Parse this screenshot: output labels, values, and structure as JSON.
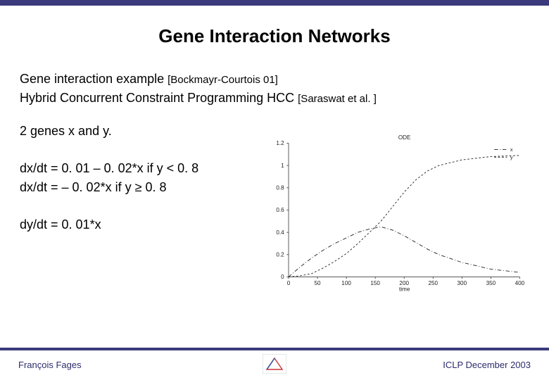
{
  "title": "Gene Interaction Networks",
  "intro": {
    "example_prefix": "Gene interaction example ",
    "example_citation": "[Bockmayr-Courtois 01]",
    "hcc_prefix": "Hybrid Concurrent Constraint Programming HCC ",
    "hcc_citation": "[Saraswat et al. ]"
  },
  "equations": {
    "genes": "2 genes x and y.",
    "dx1": "dx/dt = 0. 01 – 0. 02*x if y < 0. 8",
    "dx2": "dx/dt = – 0. 02*x if y ≥ 0. 8",
    "dy": "dy/dt = 0. 01*x"
  },
  "footer": {
    "author": "François Fages",
    "venue": "ICLP December 2003"
  },
  "chart_data": {
    "type": "line",
    "title": "ODE",
    "xlabel": "time",
    "ylabel": "",
    "xlim": [
      0,
      400
    ],
    "ylim": [
      0,
      1.2
    ],
    "xticks": [
      0,
      50,
      100,
      150,
      200,
      250,
      300,
      350,
      400
    ],
    "yticks": [
      0,
      0.2,
      0.4,
      0.6,
      0.8,
      1,
      1.2
    ],
    "x": [
      0,
      20,
      40,
      60,
      80,
      100,
      120,
      140,
      160,
      180,
      200,
      220,
      240,
      260,
      300,
      350,
      400
    ],
    "series": [
      {
        "name": "x",
        "style": "dashdot",
        "values": [
          0.0,
          0.09,
          0.17,
          0.24,
          0.3,
          0.35,
          0.4,
          0.43,
          0.45,
          0.42,
          0.37,
          0.31,
          0.25,
          0.2,
          0.13,
          0.07,
          0.04
        ]
      },
      {
        "name": "y",
        "style": "dashed",
        "values": [
          0.0,
          0.01,
          0.03,
          0.08,
          0.14,
          0.21,
          0.3,
          0.4,
          0.5,
          0.63,
          0.76,
          0.87,
          0.95,
          1.0,
          1.05,
          1.08,
          1.09
        ]
      }
    ],
    "legend_pos": "top-right"
  }
}
